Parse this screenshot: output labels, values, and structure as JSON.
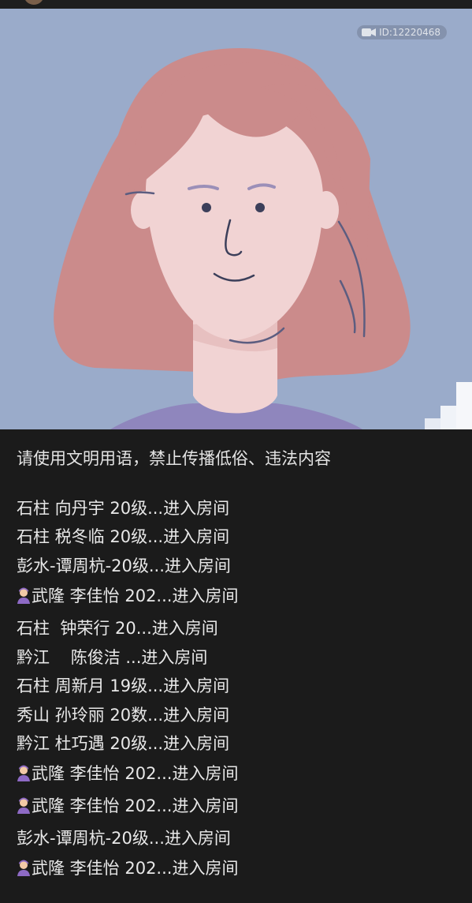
{
  "stream": {
    "id_text": "ID:12220468",
    "id_icon": "camera-icon",
    "signal_icon": "signal-bars-icon"
  },
  "chat": {
    "notice": "请使用文明用语，禁止传播低俗、违法内容",
    "messages": [
      {
        "text": "石柱 向丹宇 20级...进入房间",
        "icon": ""
      },
      {
        "text": "石柱 税冬临 20级...进入房间",
        "icon": ""
      },
      {
        "text": "彭水-谭周杭-20级...进入房间",
        "icon": ""
      },
      {
        "text": "武隆 李佳怡 202...进入房间",
        "icon": "user-badge-icon"
      },
      {
        "text": "石柱  钟荣行 20...进入房间",
        "icon": ""
      },
      {
        "text": "黔江    陈俊洁 ...进入房间",
        "icon": ""
      },
      {
        "text": "石柱 周新月 19级...进入房间",
        "icon": ""
      },
      {
        "text": "秀山 孙玲丽 20数...进入房间",
        "icon": ""
      },
      {
        "text": "黔江 杜巧遇 20级...进入房间",
        "icon": ""
      },
      {
        "text": "武隆 李佳怡 202...进入房间",
        "icon": "user-badge-icon"
      },
      {
        "text": "武隆 李佳怡 202...进入房间",
        "icon": "user-badge-icon"
      },
      {
        "text": "彭水-谭周杭-20级...进入房间",
        "icon": ""
      },
      {
        "text": "武隆 李佳怡 202...进入房间",
        "icon": "user-badge-icon"
      }
    ]
  }
}
